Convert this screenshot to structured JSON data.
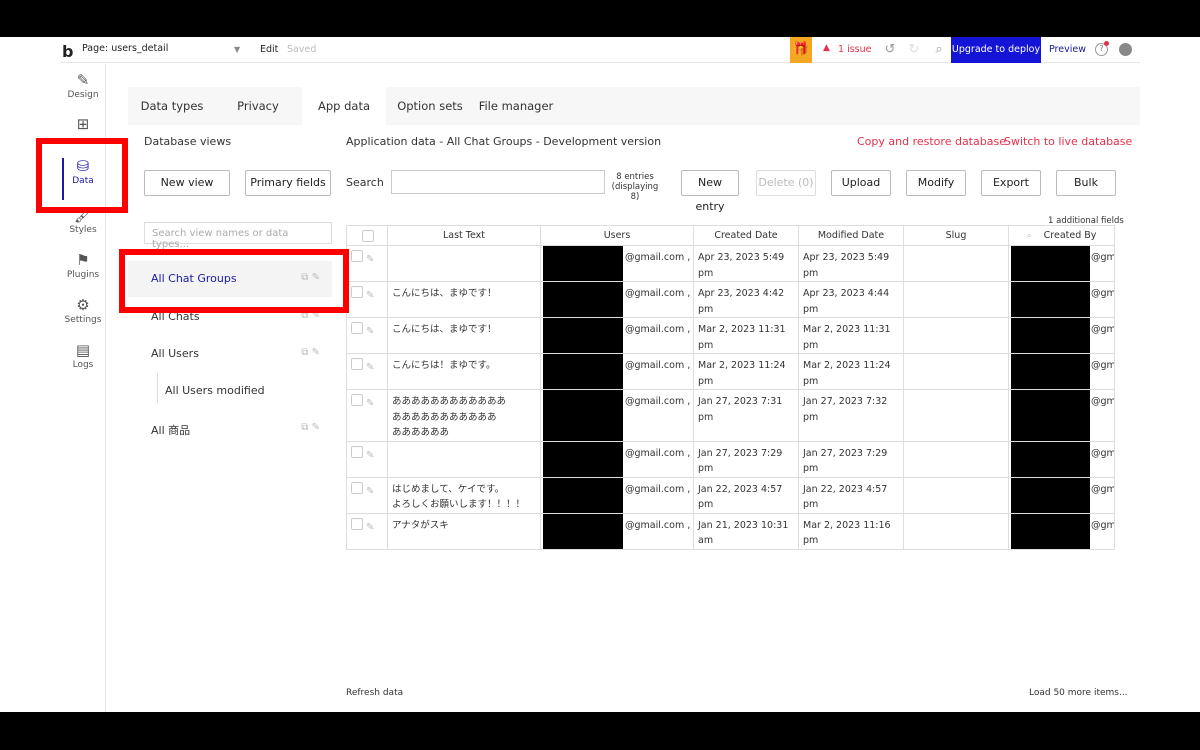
{
  "topbar": {
    "logo": "b",
    "page_label": "Page: users_detail",
    "edit_label": "Edit",
    "saved_label": "Saved",
    "issue_label": "1 issue",
    "upgrade_label": "Upgrade to deploy",
    "preview_label": "Preview"
  },
  "rail": {
    "items": [
      {
        "label": "Design",
        "icon": "design-icon"
      },
      {
        "label": "",
        "icon": "workflow-icon"
      },
      {
        "label": "Data",
        "icon": "data-icon"
      },
      {
        "label": "Styles",
        "icon": "styles-icon"
      },
      {
        "label": "Plugins",
        "icon": "plugins-icon"
      },
      {
        "label": "Settings",
        "icon": "settings-icon"
      },
      {
        "label": "Logs",
        "icon": "logs-icon"
      }
    ]
  },
  "tabs": [
    {
      "label": "Data types"
    },
    {
      "label": "Privacy"
    },
    {
      "label": "App data",
      "active": true
    },
    {
      "label": "Option sets"
    },
    {
      "label": "File manager"
    }
  ],
  "dbviews": {
    "title": "Database views",
    "new_view": "New view",
    "primary_fields": "Primary fields",
    "search_placeholder": "Search view names or data types...",
    "items": [
      {
        "label": "All Chat Groups",
        "selected": true
      },
      {
        "label": "All Chats"
      },
      {
        "label": "All Users"
      },
      {
        "label": "All Users modified",
        "sub": true
      },
      {
        "label": "All 商品"
      }
    ]
  },
  "appdata": {
    "title": "Application data - All Chat Groups - Development version",
    "copy_restore": "Copy and restore database",
    "switch_live": "Switch to live database",
    "search_label": "Search",
    "entries_line1": "8 entries",
    "entries_line2": "(displaying 8)",
    "new_entry": "New entry",
    "delete": "Delete (0)",
    "upload": "Upload",
    "modify": "Modify",
    "export": "Export",
    "bulk": "Bulk",
    "additional_fields": "1 additional fields",
    "refresh": "Refresh data",
    "load_more": "Load 50 more items..."
  },
  "table": {
    "columns": [
      "Last Text",
      "Users",
      "Created Date",
      "Modified Date",
      "Slug",
      "Created By"
    ],
    "rows": [
      {
        "last_text": "",
        "users": "@gmail.com ,\n@gmail.com",
        "created": "Apr 23, 2023 5:49 pm",
        "modified": "Apr 23, 2023 5:49 pm",
        "slug": "",
        "created_by": "@gm"
      },
      {
        "last_text": "こんにちは、まゆです！",
        "users": "@gmail.com ,\n@gmail.com",
        "created": "Apr 23, 2023 4:42 pm",
        "modified": "Apr 23, 2023 4:44 pm",
        "slug": "",
        "created_by": "@gm"
      },
      {
        "last_text": "こんにちは、まゆです！",
        "users": "@gmail.com ,\nail.com",
        "created": "Mar 2, 2023 11:31 pm",
        "modified": "Mar 2, 2023 11:31 pm",
        "slug": "",
        "created_by": "@gm"
      },
      {
        "last_text": "こんにちは！まゆです。",
        "users": "@gmail.com ,\n@gmail.com",
        "created": "Mar 2, 2023 11:24 pm",
        "modified": "Mar 2, 2023 11:24 pm",
        "slug": "",
        "created_by": "@gm"
      },
      {
        "last_text": "ああああああああああああ\nあああああああああああ\nああああああ",
        "users": "@gmail.com ,\n@gmail.com",
        "created": "Jan 27, 2023 7:31 pm",
        "modified": "Jan 27, 2023 7:32 pm",
        "slug": "",
        "created_by": "@gm"
      },
      {
        "last_text": "",
        "users": "@gmail.com ,\nail.com",
        "created": "Jan 27, 2023 7:29 pm",
        "modified": "Jan 27, 2023 7:29 pm",
        "slug": "",
        "created_by": "@gm"
      },
      {
        "last_text": "はじめまして、ケイです。\nよろしくお願いします！！！！",
        "users": "@gmail.com ,\n@gmail.com",
        "created": "Jan 22, 2023 4:57 pm",
        "modified": "Jan 22, 2023 4:57 pm",
        "slug": "",
        "created_by": "@gm"
      },
      {
        "last_text": "アナタがスキ",
        "users": "@gmail.com ,\n@gmail.com",
        "created": "Jan 21, 2023 10:31 am",
        "modified": "Mar 2, 2023 11:16 pm",
        "slug": "",
        "created_by": "@gm"
      }
    ]
  },
  "colors": {
    "accent": "#1a1aa6",
    "danger": "#e5304c",
    "upgrade": "#1414d7",
    "gift": "#f5a623",
    "highlight": "#ff0000"
  }
}
